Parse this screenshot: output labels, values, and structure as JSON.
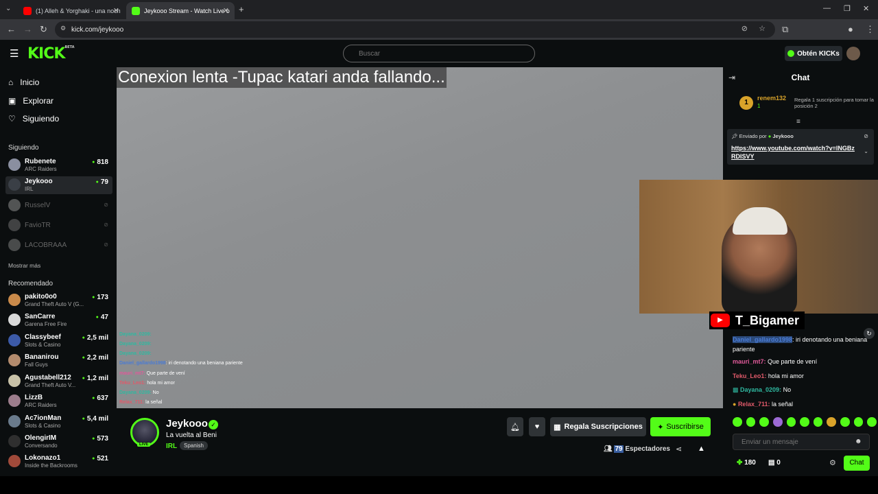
{
  "browser": {
    "tabs": [
      {
        "title": "(1) Alleh & Yorghaki - una noch",
        "active": false
      },
      {
        "title": "Jeykooo Stream - Watch Live o",
        "active": true
      }
    ],
    "url": "kick.com/jeykooo"
  },
  "header": {
    "logo": "KICK",
    "logo_sup": "BETA",
    "search_placeholder": "Buscar",
    "get_kicks": "Obtén KICKs"
  },
  "sidebar": {
    "nav": [
      {
        "label": "Inicio",
        "icon": "home-icon"
      },
      {
        "label": "Explorar",
        "icon": "compass-icon"
      },
      {
        "label": "Siguiendo",
        "icon": "heart-icon"
      }
    ],
    "following_title": "Siguiendo",
    "following": [
      {
        "name": "Rubenete",
        "category": "ARC Raiders",
        "viewers": "818",
        "live": true
      },
      {
        "name": "Jeykooo",
        "category": "IRL",
        "viewers": "79",
        "live": true
      },
      {
        "name": "RusselV",
        "category": "",
        "viewers": "",
        "live": false
      },
      {
        "name": "FavioTR",
        "category": "",
        "viewers": "",
        "live": false
      },
      {
        "name": "LACOBRAAA",
        "category": "",
        "viewers": "",
        "live": false
      }
    ],
    "show_more": "Mostrar más",
    "recommended_title": "Recomendado",
    "recommended": [
      {
        "name": "pakito0o0",
        "category": "Grand Theft Auto V (G...",
        "viewers": "173"
      },
      {
        "name": "SanCarre",
        "category": "Garena Free Fire",
        "viewers": "47"
      },
      {
        "name": "Classybeef",
        "category": "Slots & Casino",
        "viewers": "2,5 mil"
      },
      {
        "name": "Bananirou",
        "category": "Fall Guys",
        "viewers": "2,2 mil"
      },
      {
        "name": "Agustabell212",
        "category": "Grand Theft Auto V...",
        "viewers": "1,2 mil"
      },
      {
        "name": "LizzB",
        "category": "ARC Raiders",
        "viewers": "637"
      },
      {
        "name": "Ac7ionMan",
        "category": "Slots & Casino",
        "viewers": "5,4 mil"
      },
      {
        "name": "OlengirIM",
        "category": "Conversando",
        "viewers": "573"
      },
      {
        "name": "Lokonazo1",
        "category": "Inside the Backrooms",
        "viewers": "521"
      }
    ]
  },
  "video": {
    "banner": "Conexion lenta -Tupac katari anda fallando...",
    "overlay_chat": [
      {
        "user": "Dayana_0209:",
        "text": "",
        "color": "#2fb8a0"
      },
      {
        "user": "Dayana_0209:",
        "text": "",
        "color": "#2fb8a0"
      },
      {
        "user": "Dayana_0209:",
        "text": "",
        "color": "#2fb8a0"
      },
      {
        "user": "Daniel_gallardo1998",
        "text": ": iri denotando una beniana pariente",
        "color": "#4a7bd4"
      },
      {
        "user": "mauri_mt7:",
        "text": " Que parte de vení",
        "color": "#e05a9a"
      },
      {
        "user": "Teku_Leo1:",
        "text": " hola mi amor",
        "color": "#e05a6a"
      },
      {
        "user": "Dayana_0209:",
        "text": " No",
        "color": "#2fb8a0"
      },
      {
        "user": "Relax_711:",
        "text": " la señal",
        "color": "#e05a6a"
      }
    ],
    "webcam_name": "T_Bigamer"
  },
  "stream": {
    "channel": "Jeykooo",
    "title": "La vuelta al Beni",
    "category": "IRL",
    "language": "Spanish",
    "live_label": "LIVE",
    "gift_label": "Regala Suscripciones",
    "subscribe_label": "Suscribirse",
    "viewers": "79",
    "viewers_label": "Espectadores"
  },
  "chat": {
    "title": "Chat",
    "leader": {
      "rank": "1",
      "name": "renem132",
      "count": "1",
      "cta": "Regala 1 suscripción para tomar la posición 2"
    },
    "pinned": {
      "sent_by": "Enviado por",
      "author": "Jeykooo",
      "link": "https://www.youtube.com/watch?v=lNGBzRDISVY"
    },
    "messages": [
      {
        "user": "Daniel_gallardo1998",
        "text": ": iri denotando una beniana pariente",
        "color": "#4a7bd4"
      },
      {
        "user": "mauri_mt7:",
        "text": " Que parte de vení",
        "color": "#e05a9a"
      },
      {
        "user": "Teku_Leo1:",
        "text": " hola mi amor",
        "color": "#e05a6a"
      },
      {
        "user": "Dayana_0209:",
        "text": " No",
        "color": "#2fb8a0"
      },
      {
        "user": "Relax_711:",
        "text": " la señal",
        "color": "#e05a6a"
      }
    ],
    "input_placeholder": "Enviar un mensaje",
    "points": "180",
    "zero": "0",
    "chat_button": "Chat"
  },
  "colors": {
    "accent": "#53fc18",
    "bg": "#0b0e0f"
  }
}
